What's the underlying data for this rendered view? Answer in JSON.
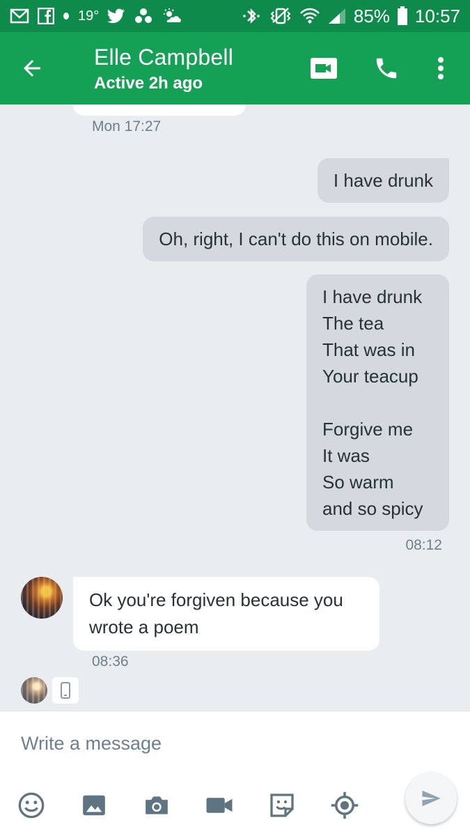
{
  "status_bar": {
    "temperature": "19°",
    "battery": "85%",
    "time": "10:57",
    "icons": [
      "gmail-icon",
      "facebook-icon",
      "dot-icon",
      "twitter-icon",
      "app-icon",
      "weather-icon",
      "bluetooth-icon",
      "vibrate-icon",
      "wifi-icon",
      "signal-icon",
      "battery-icon"
    ]
  },
  "header": {
    "contact_name": "Elle Campbell",
    "contact_status": "Active 2h ago",
    "icons": [
      "back-arrow-icon",
      "video-call-icon",
      "phone-icon",
      "more-vert-icon"
    ]
  },
  "messages": {
    "ts_mon": "Mon 17:27",
    "out1": "I have drunk",
    "out2": "Oh, right, I can't do this on mobile.",
    "poem": [
      "I have drunk",
      "The tea",
      "That was in",
      "Your teacup",
      "",
      "Forgive me",
      "It was",
      "So warm",
      "and so spicy"
    ],
    "ts_poem": "08:12",
    "in1": "Ok you're forgiven because you wrote a poem",
    "ts_in1": "08:36"
  },
  "composer": {
    "placeholder": "Write a message",
    "tools": [
      "emoji-icon",
      "gallery-icon",
      "camera-icon",
      "video-icon",
      "sticker-icon",
      "location-icon",
      "send-icon"
    ]
  },
  "colors": {
    "status_bar": "#0e8a4a",
    "app_bar": "#14a055",
    "chat_bg": "#e9edf0",
    "outgoing_bubble": "#d3d9df",
    "incoming_bubble": "#ffffff",
    "icon_gray": "#5f7482"
  }
}
